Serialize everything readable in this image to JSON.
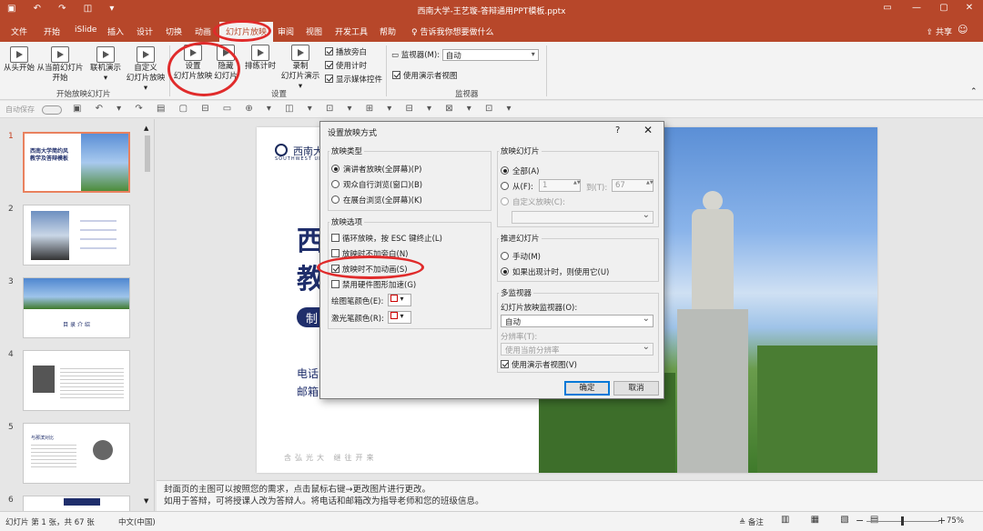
{
  "window": {
    "title": "西南大学-王艺璇-答辩通用PPT模板.pptx",
    "qa_icons": "▣ ↶ ↷ ◫ ▾",
    "share": "共享"
  },
  "tabs": [
    {
      "label": "文件"
    },
    {
      "label": "开始"
    },
    {
      "label": "iSlide"
    },
    {
      "label": "插入"
    },
    {
      "label": "设计"
    },
    {
      "label": "切换"
    },
    {
      "label": "动画"
    },
    {
      "label": "幻灯片放映"
    },
    {
      "label": "审阅"
    },
    {
      "label": "视图"
    },
    {
      "label": "开发工具"
    },
    {
      "label": "帮助"
    }
  ],
  "tell_me": "告诉我你想要做什么",
  "ribbon": {
    "from_start": "从头开始",
    "from_current_1": "从当前幻灯片",
    "from_current_2": "开始",
    "online_1": "联机演示",
    "online_2": "▾",
    "custom_1": "自定义",
    "custom_2": "幻灯片放映 ▾",
    "group_start": "开始放映幻灯片",
    "setup_1": "设置",
    "setup_2": "幻灯片放映",
    "hide_1": "隐藏",
    "hide_2": "幻灯片",
    "rehearse": "排练计时",
    "record_1": "录制",
    "record_2": "幻灯片演示 ▾",
    "chk_narration": "播放旁白",
    "chk_timings": "使用计时",
    "chk_media": "显示媒体控件",
    "group_setup": "设置",
    "monitor_label": "监视器(M):",
    "monitor_value": "自动",
    "presenter_view": "使用演示者视图",
    "group_monitors": "监视器"
  },
  "quick": {
    "autosave": "自动保存",
    "toggle": "关",
    "icons": "▣ ↶ ▾ ↷ ▤ ▢ ⊟ ▭ ⊕ ▾ ◫ ▾ ⊡ ▾ ⊞ ▾ ⊟ ▾ ⊠ ▾ ⊡ ▾"
  },
  "slides": [
    {
      "num": "1"
    },
    {
      "num": "2"
    },
    {
      "num": "3"
    },
    {
      "num": "4"
    },
    {
      "num": "5"
    },
    {
      "num": "6"
    }
  ],
  "slide_thumbs": {
    "s1_title_1": "西南大学简约风",
    "s1_title_2": "教学及答辩模板",
    "s3_title": "目 录 介 绍",
    "s5_title": "与那滨对比"
  },
  "slide": {
    "logo": "西南大学",
    "logo_sub": "SOUTHWEST UNIVERSITY",
    "big_line_1": "西",
    "big_line_2": "教",
    "tag": "制",
    "contact_1": "电话",
    "contact_2": "邮箱",
    "motto": "含弘光大 继往开来"
  },
  "notes": {
    "line1": "封面页的主图可以按照您的需求，点击鼠标右键→更改图片进行更改。",
    "line2": "如用于答辩，可将授课人改为答辩人。将电话和邮箱改为指导老师和您的班级信息。"
  },
  "status": {
    "slide_count": "幻灯片 第 1 张，共 67 张",
    "language": "中文(中国)",
    "notes": "≜ 备注",
    "views": "▥ ▦ ▧ ▤",
    "zoom": "75%",
    "minus": "−",
    "plus": "+"
  },
  "dialog": {
    "title": "设置放映方式",
    "help": "?",
    "close": "✕",
    "show_type_label": "放映类型",
    "type_presenter": "演讲者放映(全屏幕)(P)",
    "type_individual": "观众自行浏览(窗口)(B)",
    "type_kiosk": "在展台浏览(全屏幕)(K)",
    "options_label": "放映选项",
    "opt_loop": "循环放映，按 ESC 键终止(L)",
    "opt_no_narration": "放映时不加旁白(N)",
    "opt_no_animation": "放映时不加动画(S)",
    "opt_no_hwaccel": "禁用硬件图形加速(G)",
    "pen_color": "绘图笔颜色(E):",
    "laser_color": "激光笔颜色(R):",
    "slides_label": "放映幻灯片",
    "slides_all": "全部(A)",
    "slides_from": "从(F):",
    "from_value": "1",
    "to_label": "到(T):",
    "to_value": "67",
    "slides_custom": "自定义放映(C):",
    "advance_label": "推进幻灯片",
    "advance_manual": "手动(M)",
    "advance_timings": "如果出现计时，则使用它(U)",
    "monitors_label": "多监视器",
    "monitor_field": "幻灯片放映监视器(O):",
    "monitor_value": "自动",
    "resolution_field": "分辨率(T):",
    "resolution_value": "使用当前分辨率",
    "presenter_view": "使用演示者视图(V)",
    "ok": "确定",
    "cancel": "取消"
  },
  "colors": {
    "accent": "#b7472a",
    "annotation": "#e02b2b",
    "slide_navy": "#1f2e6b"
  }
}
